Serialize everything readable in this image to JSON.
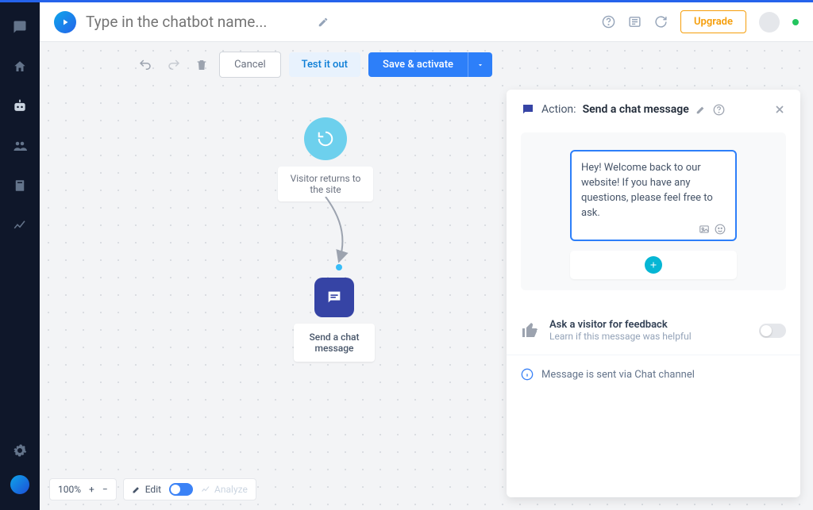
{
  "header": {
    "name_placeholder": "Type in the chatbot name...",
    "upgrade_label": "Upgrade"
  },
  "toolbar": {
    "cancel_label": "Cancel",
    "test_label": "Test it out",
    "save_label": "Save & activate"
  },
  "nodes": {
    "trigger_label": "Visitor returns to the site",
    "action_label": "Send a chat message"
  },
  "bottom": {
    "zoom_label": "100%",
    "edit_label": "Edit",
    "analyze_label": "Analyze"
  },
  "panel": {
    "action_prefix": "Action:",
    "action_name": "Send a chat message",
    "message_text": "Hey! Welcome back to our website! If you have any questions, please feel free to ask.",
    "feedback_title": "Ask a visitor for feedback",
    "feedback_sub": "Learn if this message was helpful",
    "info_text": "Message is sent via Chat channel"
  }
}
